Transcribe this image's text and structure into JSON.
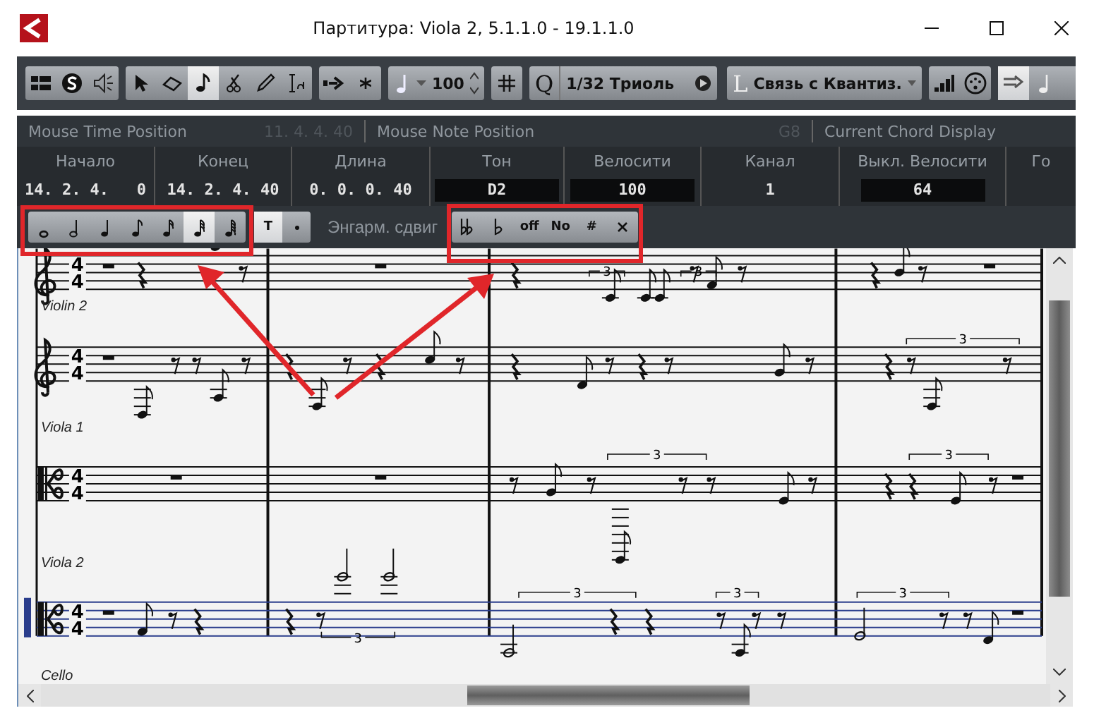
{
  "window": {
    "title": "Партитура: Viola 2, 5.1.1.0 - 19.1.1.0"
  },
  "toolbar": {
    "tools": [
      {
        "kind": "arrow",
        "selected": false
      },
      {
        "kind": "eraser",
        "selected": false
      },
      {
        "kind": "note",
        "selected": true
      },
      {
        "kind": "scissors",
        "selected": false
      },
      {
        "kind": "pencil",
        "selected": false
      },
      {
        "kind": "text",
        "selected": false
      }
    ],
    "velocity": "100",
    "quantize_label": "Q",
    "quantize": "1/32 Триоль",
    "length_label": "L",
    "length_quantize": "Связь с Квантиз."
  },
  "info_line": {
    "mouse_time_label": "Mouse Time Position",
    "mouse_time": "11. 4. 4. 40",
    "mouse_note_label": "Mouse Note Position",
    "mouse_note": "G8",
    "chord_label": "Current Chord Display"
  },
  "note_info": [
    {
      "label": "Начало",
      "value": "14. 2. 4.   0",
      "kind": "plain"
    },
    {
      "label": "Конец",
      "value": "14. 2. 4. 40",
      "kind": "plain"
    },
    {
      "label": "Длина",
      "value": "0. 0. 0. 40",
      "kind": "plain"
    },
    {
      "label": "Тон",
      "value": "D2",
      "kind": "field"
    },
    {
      "label": "Велосити",
      "value": "100",
      "kind": "field"
    },
    {
      "label": "Канал",
      "value": "1",
      "kind": "plain"
    },
    {
      "label": "Выкл. Велосити",
      "value": "64",
      "kind": "field"
    },
    {
      "label": "Го"
    }
  ],
  "extended_toolbar": {
    "note_values": [
      {
        "kind": "whole",
        "selected": false
      },
      {
        "kind": "half",
        "selected": false
      },
      {
        "kind": "quarter",
        "selected": false
      },
      {
        "kind": "eighth",
        "selected": false
      },
      {
        "kind": "sixteenth",
        "selected": false
      },
      {
        "kind": "thirty_second",
        "selected": true
      },
      {
        "kind": "sixty_fourth",
        "selected": false
      }
    ],
    "text_button": {
      "label": "T",
      "selected": true
    },
    "enharmonic_label": "Энгарм. сдвиг",
    "enharmonic": [
      {
        "kind": "double_flat"
      },
      {
        "kind": "flat"
      },
      {
        "kind": "text",
        "label": "off"
      },
      {
        "kind": "text",
        "label": "No"
      },
      {
        "kind": "text",
        "label": "#"
      },
      {
        "kind": "double_sharp"
      }
    ]
  },
  "score": {
    "staves": [
      {
        "name": "Violin 2",
        "kind": "treble",
        "time_signature": [
          "4",
          "4"
        ],
        "selected": false,
        "tuplets": [
          "3",
          "3"
        ]
      },
      {
        "name": "Viola 1",
        "kind": "treble",
        "time_signature": [
          "4",
          "4"
        ],
        "selected": false,
        "tuplets": [
          "3"
        ]
      },
      {
        "name": "Viola 2",
        "kind": "alto",
        "time_signature": [
          "4",
          "4"
        ],
        "selected": false,
        "tuplets": [
          "3",
          "3"
        ]
      },
      {
        "name": "Cello",
        "kind": "alto",
        "time_signature": [
          "4",
          "4"
        ],
        "selected": true,
        "tuplets": [
          "3",
          "3",
          "3",
          "3"
        ]
      }
    ]
  }
}
